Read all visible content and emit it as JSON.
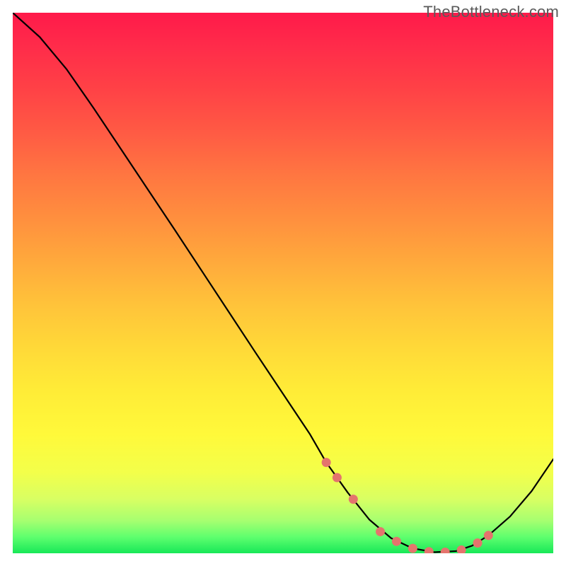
{
  "watermark": "TheBottleneck.com",
  "chart_data": {
    "type": "line",
    "title": "",
    "xlabel": "",
    "ylabel": "",
    "xlim": [
      0,
      100
    ],
    "ylim": [
      0,
      100
    ],
    "x": [
      0,
      5,
      10,
      15,
      20,
      25,
      30,
      35,
      40,
      45,
      50,
      55,
      58,
      62,
      66,
      70,
      74,
      78,
      82,
      85,
      88,
      92,
      96,
      100
    ],
    "values": [
      100,
      95.5,
      89.5,
      82.3,
      74.8,
      67.3,
      59.8,
      52.2,
      44.6,
      37.0,
      29.5,
      22.0,
      16.8,
      11.2,
      6.2,
      2.8,
      0.9,
      0.2,
      0.4,
      1.4,
      3.3,
      6.8,
      11.5,
      17.4
    ],
    "markers_x": [
      58,
      60,
      63,
      68,
      71,
      74,
      77,
      80,
      83,
      86,
      88
    ],
    "markers_y": [
      16.8,
      14.0,
      10.0,
      4.0,
      2.2,
      0.9,
      0.3,
      0.2,
      0.6,
      1.9,
      3.3
    ],
    "gradient_stops": [
      {
        "pos": 0.0,
        "color": "#ff1a4a"
      },
      {
        "pos": 0.5,
        "color": "#ffc33a"
      },
      {
        "pos": 0.8,
        "color": "#fff93a"
      },
      {
        "pos": 1.0,
        "color": "#18e858"
      }
    ]
  }
}
